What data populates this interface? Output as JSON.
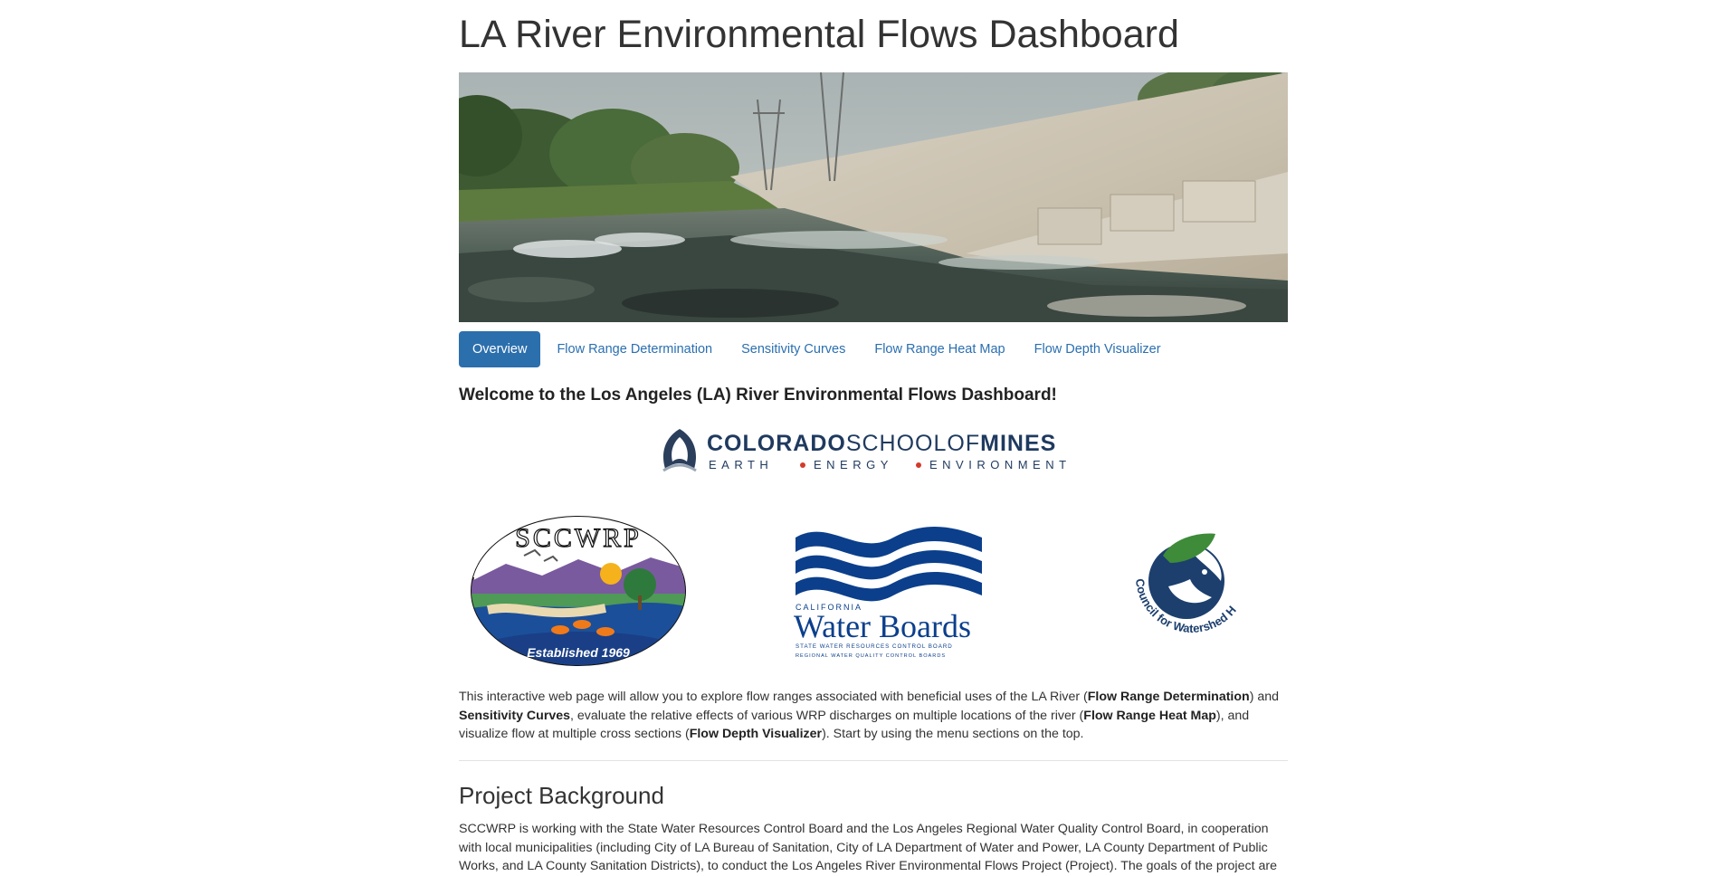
{
  "page": {
    "title": "LA River Environmental Flows Dashboard"
  },
  "tabs": [
    {
      "label": "Overview",
      "active": true
    },
    {
      "label": "Flow Range Determination",
      "active": false
    },
    {
      "label": "Sensitivity Curves",
      "active": false
    },
    {
      "label": "Flow Range Heat Map",
      "active": false
    },
    {
      "label": "Flow Depth Visualizer",
      "active": false
    }
  ],
  "overview": {
    "welcome": "Welcome to the Los Angeles (LA) River Environmental Flows Dashboard!",
    "mines_logo": {
      "line1a": "COLORADO",
      "line1b": "SCHOOLOF",
      "line1c": "MINES",
      "line2a": "EARTH",
      "line2b": "ENERGY",
      "line2c": "ENVIRONMENT"
    },
    "sccwrp_logo": {
      "name": "SCCWRP",
      "established": "Established 1969"
    },
    "waterboards_logo": {
      "state": "CALIFORNIA",
      "name": "Water Boards",
      "sub1": "STATE WATER RESOURCES CONTROL BOARD",
      "sub2": "REGIONAL WATER QUALITY CONTROL BOARDS"
    },
    "council_logo": {
      "name": "Council for Watershed Health"
    },
    "intro": {
      "t1": "This interactive web page will allow you to explore flow ranges associated with beneficial uses of the LA River (",
      "b1": "Flow Range Determination",
      "t2": ") and ",
      "b2": "Sensitivity Curves",
      "t3": ", evaluate the relative effects of various WRP discharges on multiple locations of the river (",
      "b3": "Flow Range Heat Map",
      "t4": "), and visualize flow at multiple cross sections (",
      "b4": "Flow Depth Visualizer",
      "t5": "). Start by using the menu sections on the top."
    },
    "background_heading": "Project Background",
    "background_text": "SCCWRP is working with the State Water Resources Control Board and the Los Angeles Regional Water Quality Control Board, in cooperation with local municipalities (including City of LA Bureau of Sanitation, City of LA Department of Water and Power, LA County Department of Public Works, and LA County Sanitation Districts), to conduct the Los Angeles River Environmental Flows Project (Project). The goals of the project are"
  },
  "colors": {
    "tab_active_bg": "#2c6fad",
    "link": "#2a6fb0",
    "mines_navy": "#1f3a5f",
    "mines_red": "#d23b2b",
    "waterboards_blue": "#0b3f8c",
    "council_navy": "#1c3f6e",
    "council_green": "#3e8b3a"
  }
}
